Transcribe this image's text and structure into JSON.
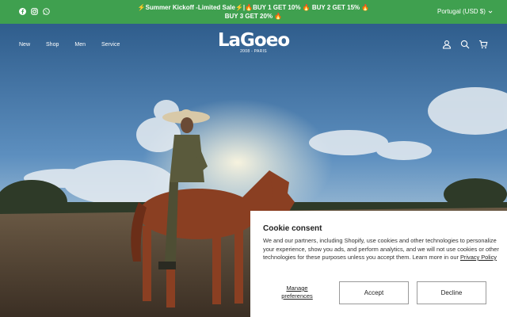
{
  "announcement": {
    "social_icons": [
      "facebook-icon",
      "instagram-icon",
      "whatsapp-icon"
    ],
    "text": "⚡Summer Kickoff -Limited Sale⚡|🔥BUY 1 GET 10% 🔥 BUY 2 GET 15% 🔥 BUY 3 GET 20% 🔥",
    "locale": "Portugal (USD $)",
    "background": "#3fa04f"
  },
  "header": {
    "nav": [
      "New",
      "Shop",
      "Men",
      "Service"
    ],
    "logo": {
      "brand": "LaGoeo",
      "tagline": "2008 - PARIS"
    },
    "icons": [
      "account-icon",
      "search-icon",
      "cart-icon"
    ]
  },
  "cookie": {
    "title": "Cookie consent",
    "body": "We and our partners, including Shopify, use cookies and other technologies to personalize your experience, show you ads, and perform analytics, and we will not use cookies or other technologies for these purposes unless you accept them. Learn more in our ",
    "policy_link": "Privacy Policy",
    "manage_label": "Manage preferences",
    "accept_label": "Accept",
    "decline_label": "Decline"
  }
}
